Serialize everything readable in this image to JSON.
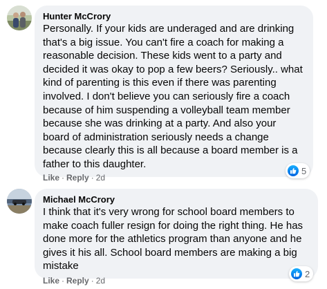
{
  "comments": [
    {
      "author": "Hunter McCrory",
      "text": "Personally. If your kids are underaged and are drinking that's a big issue. You can't fire a coach for making a reasonable decision. These kids went to a party and decided it was okay to pop a few beers? Seriously.. what kind of parenting is this even if there was parenting involved. I don't believe you can seriously fire a coach because of him suspending a volleyball team member because she was drinking at a party. And also your board of administration seriously needs a change because clearly this is all because a board member is a father to this daughter.",
      "like_label": "Like",
      "reply_label": "Reply",
      "time": "2d",
      "reaction_count": "5",
      "reaction_icon": "like-icon",
      "reaction_color": "#1877f2"
    },
    {
      "author": "Michael McCrory",
      "text": "I think that it's very wrong for school board members to make coach fuller resign for doing the right thing. He has done more for the athletics program than anyone and he gives it his all. School board members are making a big mistake",
      "like_label": "Like",
      "reply_label": "Reply",
      "time": "2d",
      "reaction_count": "2",
      "reaction_icon": "like-icon",
      "reaction_color": "#1877f2"
    }
  ]
}
